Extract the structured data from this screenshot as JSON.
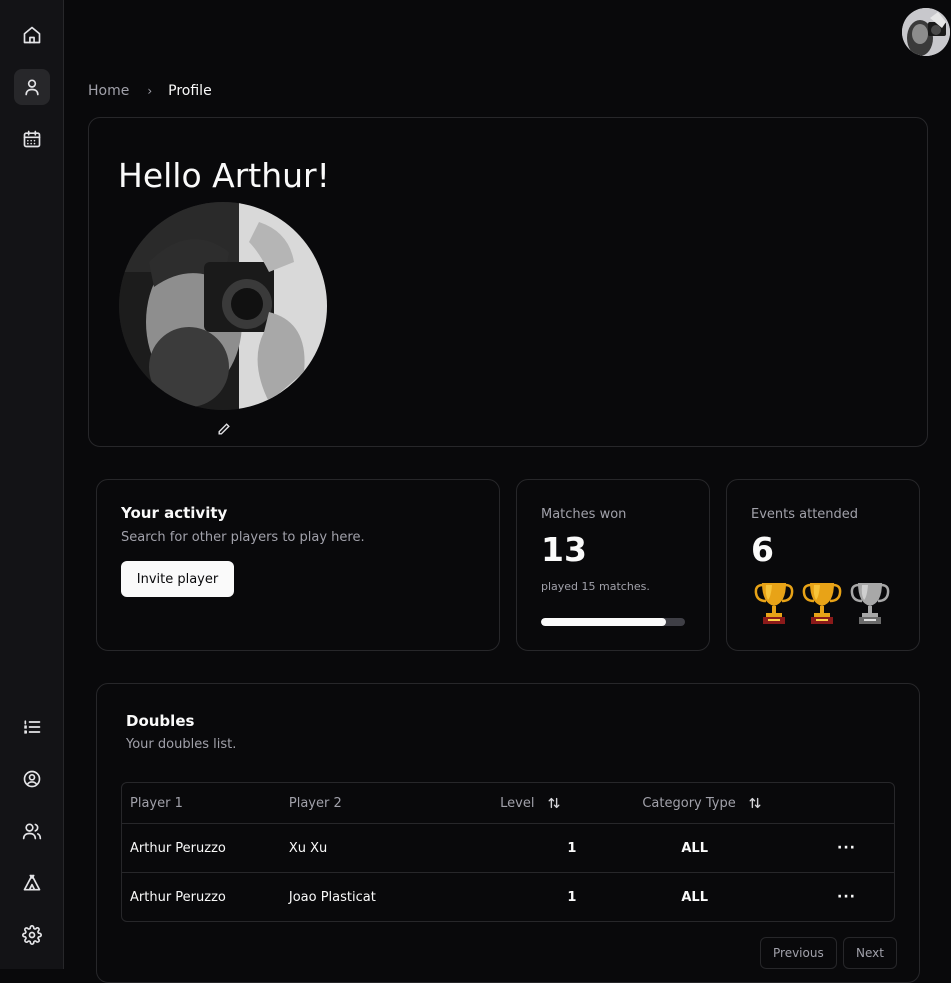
{
  "breadcrumb": {
    "home": "Home",
    "current": "Profile"
  },
  "profile": {
    "greeting": "Hello Arthur!"
  },
  "activity": {
    "title": "Your activity",
    "subtitle": "Search for other players to play here.",
    "invite_label": "Invite player"
  },
  "matches": {
    "label": "Matches won",
    "value": "13",
    "note": "played 15 matches.",
    "progress_fraction": 0.867
  },
  "events": {
    "label": "Events attended",
    "value": "6",
    "trophies": [
      "gold",
      "gold",
      "silver"
    ]
  },
  "doubles": {
    "title": "Doubles",
    "subtitle": "Your doubles list.",
    "headers": {
      "player1": "Player 1",
      "player2": "Player 2",
      "level": "Level",
      "category": "Category Type"
    },
    "rows": [
      {
        "player1": "Arthur Peruzzo",
        "player2": "Xu Xu",
        "level": "1",
        "category": "ALL",
        "actions": "···"
      },
      {
        "player1": "Arthur Peruzzo",
        "player2": "Joao Plasticat",
        "level": "1",
        "category": "ALL",
        "actions": "···"
      }
    ],
    "pagination": {
      "previous": "Previous",
      "next": "Next"
    }
  },
  "icons": {
    "sidebar_top": [
      "home-icon",
      "user-icon",
      "calendar-icon"
    ],
    "sidebar_bottom": [
      "list-icon",
      "user-circle-icon",
      "users-icon",
      "tent-icon",
      "settings-icon"
    ]
  },
  "colors": {
    "background": "#09090b",
    "border": "#27272a",
    "muted": "#a1a1aa",
    "accent": "#fafafa"
  }
}
